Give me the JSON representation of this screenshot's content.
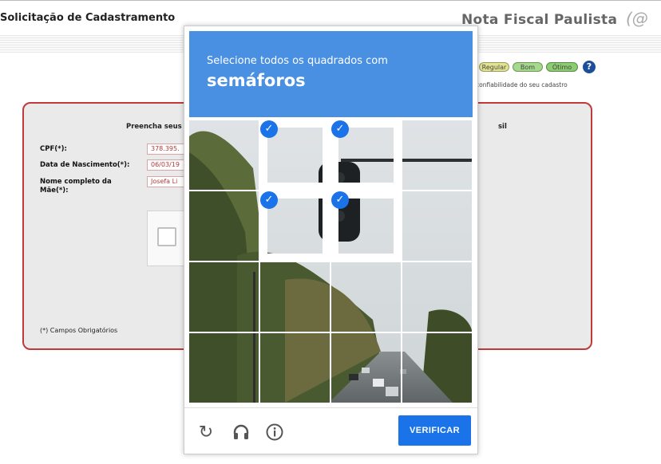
{
  "page": {
    "title": "Solicitação de Cadastramento",
    "brand": "Nota Fiscal Paulista",
    "brand_logo": "(@",
    "rating": {
      "levels": [
        "Regular",
        "Bom",
        "Ótimo"
      ],
      "help_glyph": "?",
      "caption": "confiabilidade do seu cadastro"
    }
  },
  "form": {
    "heading_left": "Preencha seus",
    "heading_right": "sil",
    "fields": [
      {
        "label": "CPF(*):",
        "value": "378.395."
      },
      {
        "label": "Data de Nascimento(*):",
        "value": "06/03/19"
      },
      {
        "label": "Nome completo da Mãe(*):",
        "value": "Josefa Li"
      }
    ],
    "required_note": "(*) Campos Obrigatórios"
  },
  "captcha": {
    "instruction": "Selecione todos os quadrados com",
    "target": "semáforos",
    "selected_tiles": [
      1,
      2,
      5,
      6
    ],
    "reload_icon": "reload-icon",
    "audio_icon": "headphones-icon",
    "info_icon": "info-icon",
    "verify_label": "VERIFICAR",
    "accent_color": "#4a90e2",
    "button_color": "#1a73e8"
  }
}
